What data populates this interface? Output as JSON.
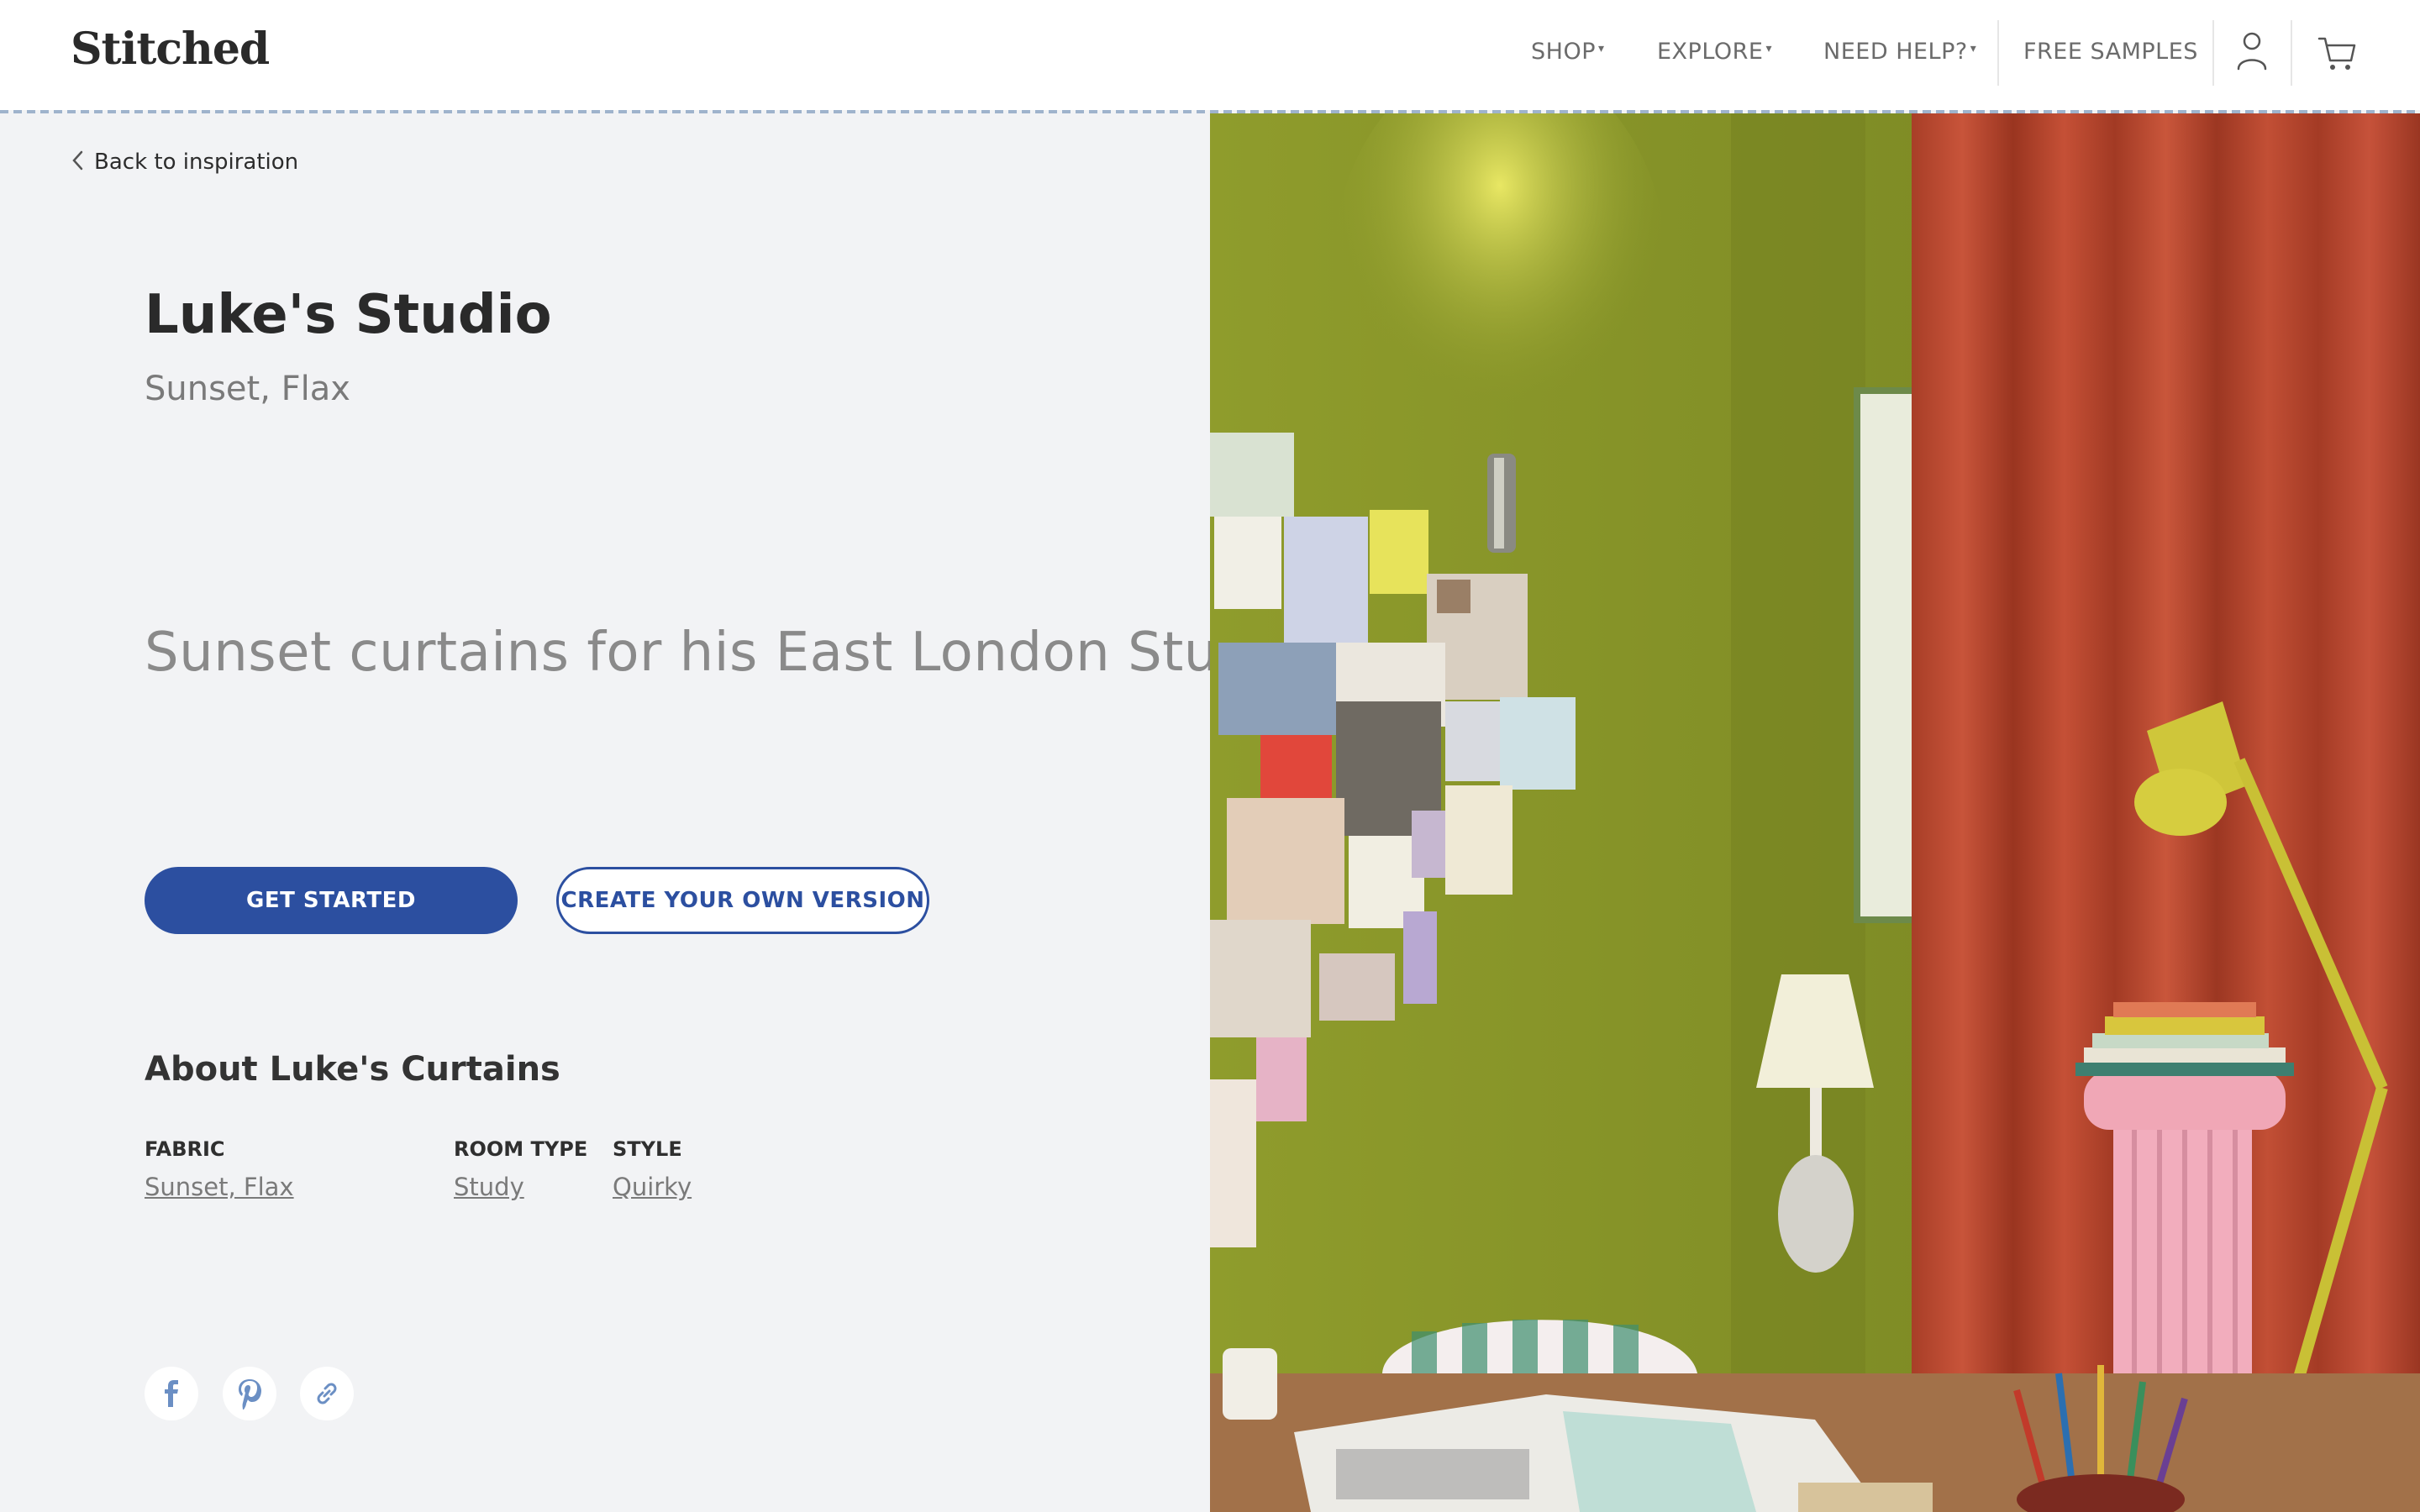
{
  "header": {
    "logo": "Stitched",
    "nav": {
      "shop": "SHOP",
      "explore": "EXPLORE",
      "need_help": "NEED HELP?",
      "free_samples": "FREE SAMPLES"
    },
    "caret": "▾"
  },
  "back_link": "Back to inspiration",
  "project": {
    "title": "Luke's Studio",
    "subtitle": "Sunset, Flax",
    "tagline": "Sunset curtains for his East London Studio"
  },
  "buttons": {
    "get_started": "GET STARTED",
    "create_own": "CREATE YOUR OWN VERSION"
  },
  "about": {
    "title": "About Luke's Curtains",
    "attributes": [
      {
        "label": "FABRIC",
        "value": "Sunset, Flax"
      },
      {
        "label": "ROOM TYPE",
        "value": "Study"
      },
      {
        "label": "STYLE",
        "value": "Quirky"
      }
    ]
  },
  "social": [
    "facebook-icon",
    "pinterest-icon",
    "link-icon"
  ],
  "colors": {
    "accent": "#2c4fa0",
    "background": "#f2f3f5",
    "wall": "#8e9a2b",
    "curtain": "#b5452b"
  }
}
